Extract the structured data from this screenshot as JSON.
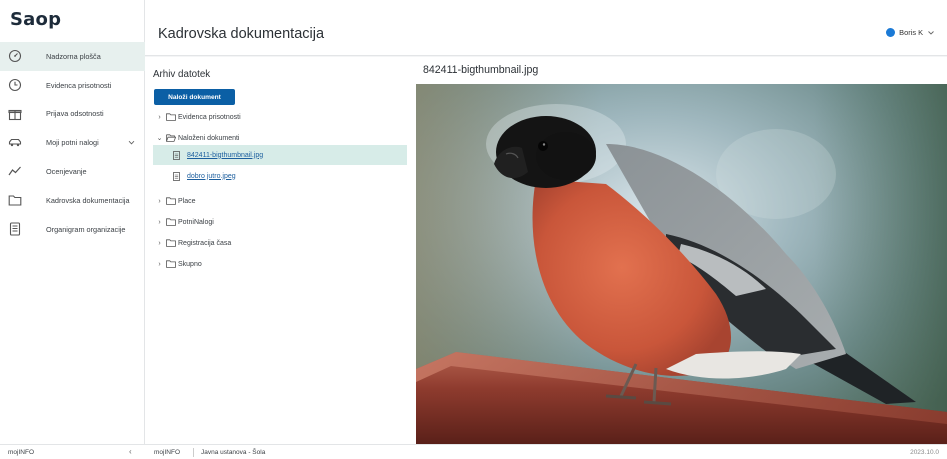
{
  "app": {
    "logo": "Saop"
  },
  "sidebar": {
    "items": [
      {
        "label": "Nadzorna plošča",
        "icon": "dashboard-icon"
      },
      {
        "label": "Evidenca prisotnosti",
        "icon": "clock-icon"
      },
      {
        "label": "Prijava odsotnosti",
        "icon": "gift-icon"
      },
      {
        "label": "Moji potni nalogi",
        "icon": "car-icon"
      },
      {
        "label": "Ocenjevanje",
        "icon": "trend-icon"
      },
      {
        "label": "Kadrovska dokumentacija",
        "icon": "folder-icon"
      },
      {
        "label": "Organigram organizacije",
        "icon": "document-icon"
      }
    ]
  },
  "header": {
    "title": "Kadrovska dokumentacija",
    "user": "Boris K"
  },
  "archive": {
    "title": "Arhiv datotek",
    "upload_label": "Naloži dokument",
    "tree": [
      {
        "label": "Evidenca prisotnosti",
        "kind": "folder",
        "expanded": false
      },
      {
        "label": "Naloženi dokumenti",
        "kind": "folder",
        "expanded": true
      },
      {
        "label": "842411-bigthumbnail.jpg",
        "kind": "file",
        "selected": true
      },
      {
        "label": "dobro jutro.jpeg",
        "kind": "file",
        "selected": false
      },
      {
        "label": "Place",
        "kind": "folder",
        "expanded": false
      },
      {
        "label": "PotniNalogi",
        "kind": "folder",
        "expanded": false
      },
      {
        "label": "Registracija časa",
        "kind": "folder",
        "expanded": false
      },
      {
        "label": "Skupno",
        "kind": "folder",
        "expanded": false
      }
    ]
  },
  "preview": {
    "title": "842411-bigthumbnail.jpg"
  },
  "footer": {
    "brand": "mojINFO",
    "brand2": "mojINFO",
    "org": "Javna ustanova - Šola",
    "version": "2023.10.0"
  },
  "colors": {
    "accent": "#0b5fa5",
    "selected_row": "#d7ece8",
    "active_nav": "#e7f0ee",
    "help": "#1b7ad6"
  }
}
